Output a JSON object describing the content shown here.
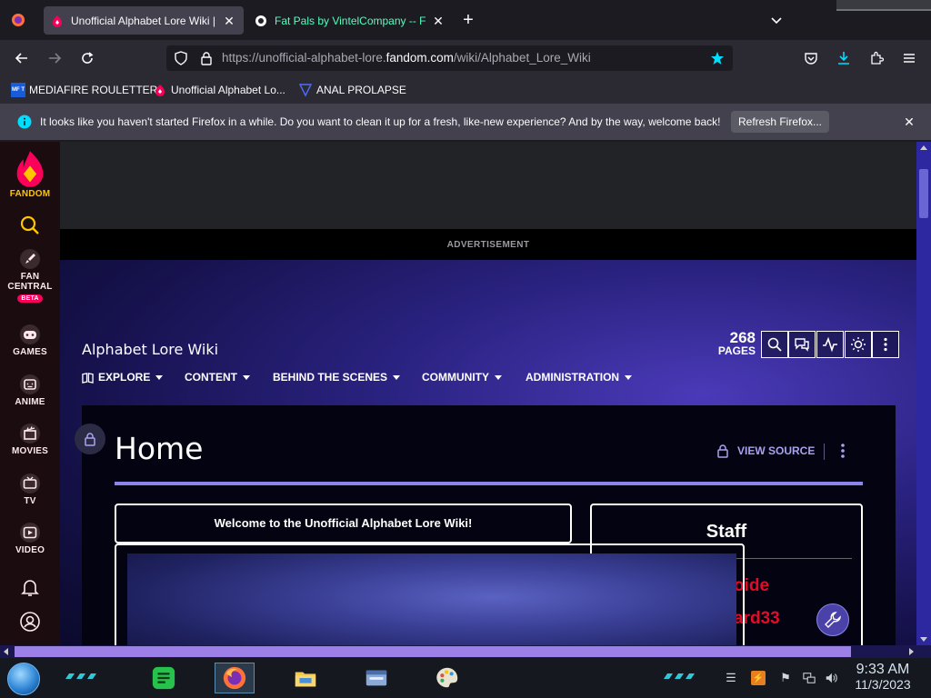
{
  "browser": {
    "tabs": [
      {
        "title": "Unofficial Alphabet Lore Wiki | F",
        "active": true
      },
      {
        "title": "Fat Pals by VintelCompany -- F",
        "active": false
      }
    ],
    "url": {
      "prefix": "https://unofficial-alphabet-lore.",
      "domain": "fandom.com",
      "path": "/wiki/Alphabet_Lore_Wiki"
    },
    "bookmarks": [
      {
        "label": "MEDIAFIRE ROULETTER",
        "icon": "mediafire-icon",
        "badge": "MF T"
      },
      {
        "label": "Unofficial Alphabet Lo...",
        "icon": "fandom-icon"
      },
      {
        "label": "ANAL PROLAPSE",
        "icon": "triangle-flag-icon"
      }
    ],
    "notification": {
      "text": "It looks like you haven't started Firefox in a while. Do you want to clean it up for a fresh, like-new experience? And by the way, welcome back!",
      "button": "Refresh Firefox..."
    }
  },
  "fandom_sidebar": {
    "brand": "FANDOM",
    "items": [
      {
        "label": "FAN",
        "label2": "CENTRAL",
        "badge": "BETA"
      },
      {
        "label": "GAMES"
      },
      {
        "label": "ANIME"
      },
      {
        "label": "MOVIES"
      },
      {
        "label": "TV"
      },
      {
        "label": "VIDEO"
      }
    ]
  },
  "ad": {
    "label": "ADVERTISEMENT"
  },
  "wiki": {
    "name": "Alphabet Lore Wiki",
    "nav": [
      "EXPLORE",
      "CONTENT",
      "BEHIND THE SCENES",
      "COMMUNITY",
      "ADMINISTRATION"
    ],
    "page_count": "268",
    "page_count_label": "PAGES",
    "page_title": "Home",
    "view_source": "VIEW SOURCE",
    "welcome": "Welcome to the Unofficial Alphabet Lore Wiki!",
    "staff_title": "Staff",
    "staff_names": [
      "oide",
      "ard33"
    ]
  },
  "taskbar": {
    "time": "9:33 AM",
    "date": "11/3/2023"
  },
  "colors": {
    "fandom_pink": "#fa005a",
    "accent_purple": "#8b85e8",
    "staff_red": "#e00d2a"
  }
}
